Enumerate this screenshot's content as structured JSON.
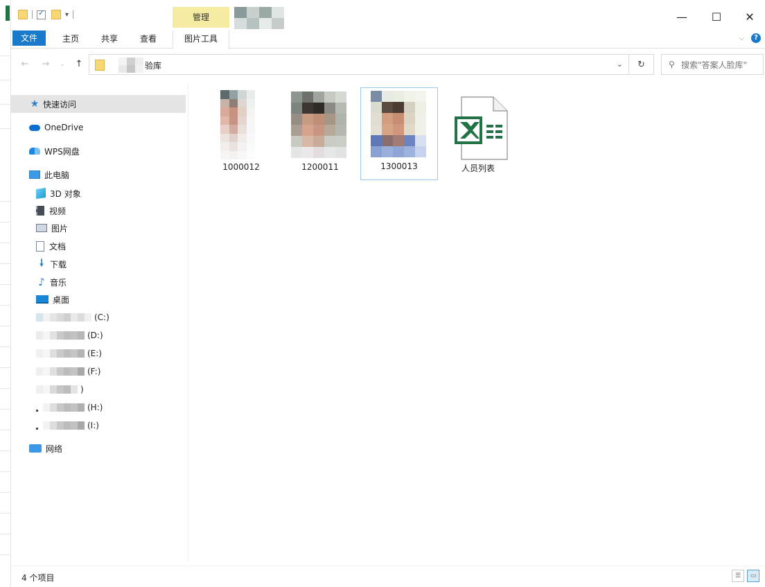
{
  "quick_access_toolbar": {
    "dropdown_glyph": "▾"
  },
  "ribbon": {
    "context_tab_group": "管理",
    "tabs": [
      "文件",
      "主页",
      "共享",
      "查看",
      "图片工具"
    ]
  },
  "window_controls": {
    "minimize": "—",
    "maximize": "☐",
    "close": "✕"
  },
  "address": {
    "path_last": "验库",
    "dropdown_glyph": "⌄",
    "refresh_glyph": "↻"
  },
  "search": {
    "placeholder": "搜索\"答案人脸库\""
  },
  "nav": {
    "quick_access": "快速访问",
    "onedrive": "OneDrive",
    "wps": "WPS网盘",
    "this_pc": "此电脑",
    "items": [
      "3D 对象",
      "视频",
      "图片",
      "文档",
      "下载",
      "音乐",
      "桌面"
    ],
    "drives": [
      "(C:)",
      "(D:)",
      "(E:)",
      "(F:)",
      ")",
      "(H:)",
      "(I:)"
    ],
    "network": "网络"
  },
  "files": [
    {
      "name": "1000012",
      "type": "image"
    },
    {
      "name": "1200011",
      "type": "image"
    },
    {
      "name": "1300013",
      "type": "image",
      "selected": true
    },
    {
      "name": "人员列表",
      "type": "excel"
    }
  ],
  "status": {
    "item_count": "4 个项目"
  },
  "colors": {
    "accent": "#1979ca",
    "manage_tab": "#f5eca2",
    "excel_green": "#217346"
  }
}
